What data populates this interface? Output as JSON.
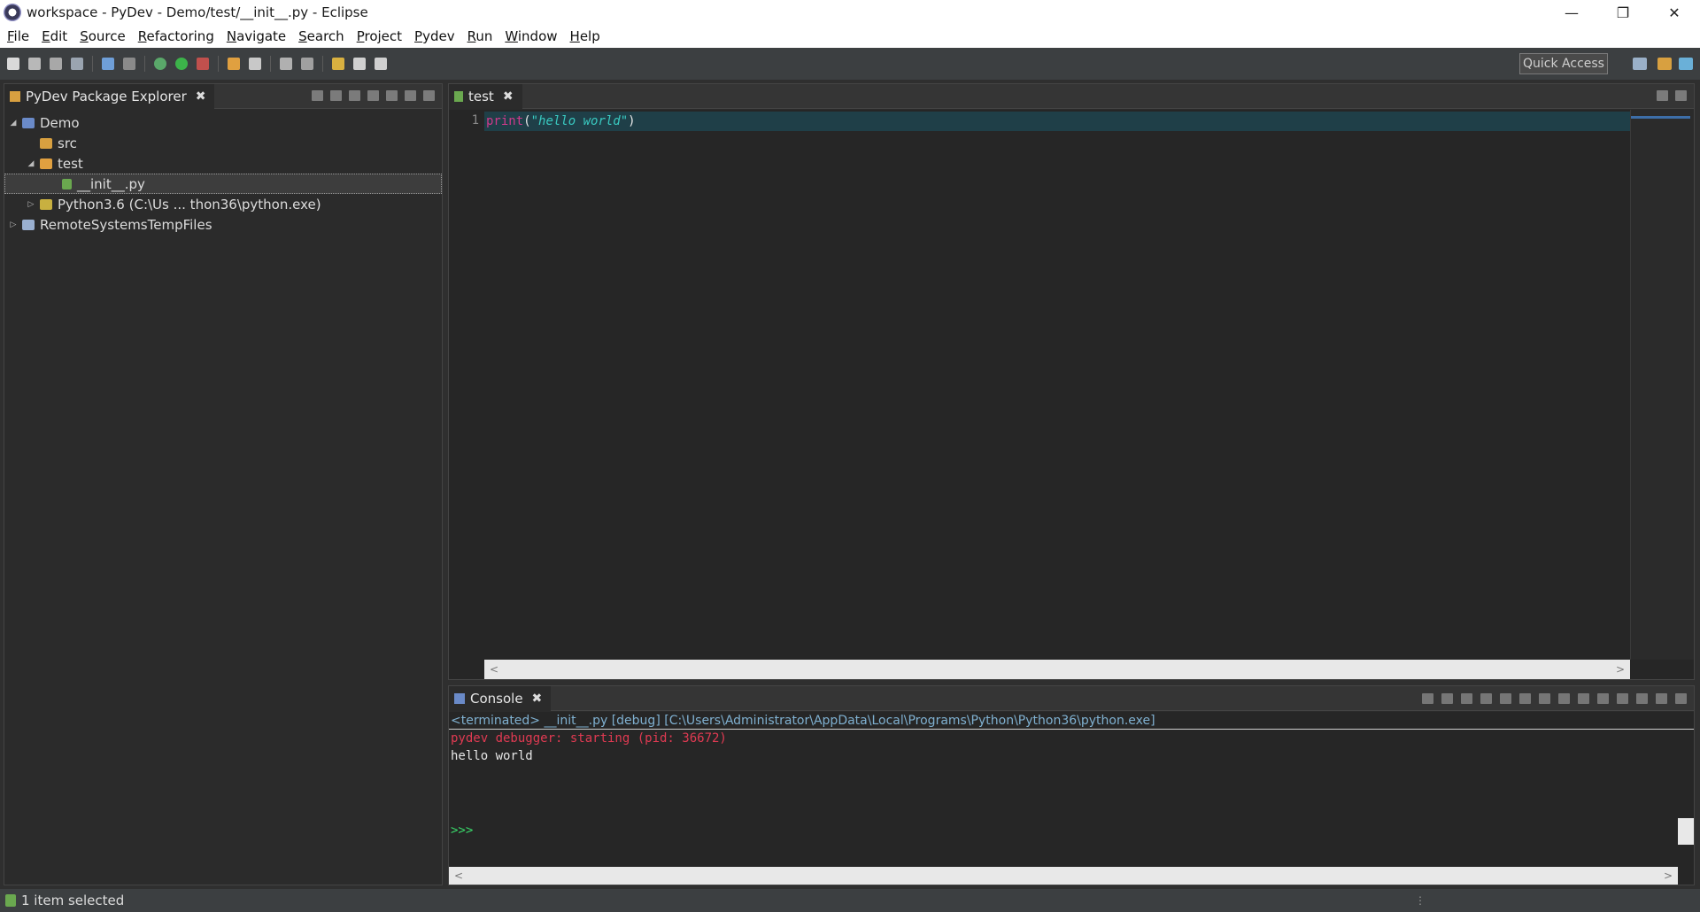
{
  "window": {
    "title": "workspace - PyDev - Demo/test/__init__.py - Eclipse",
    "controls": {
      "minimize": "—",
      "restore": "❐",
      "close": "✕"
    }
  },
  "menu": [
    "File",
    "Edit",
    "Source",
    "Refactoring",
    "Navigate",
    "Search",
    "Project",
    "Pydev",
    "Run",
    "Window",
    "Help"
  ],
  "toolbar": {
    "quick_access": "Quick Access"
  },
  "explorer": {
    "title": "PyDev Package Explorer",
    "close": "✖",
    "tree": [
      {
        "label": "Demo",
        "twisty": "◢"
      },
      {
        "label": "src",
        "twisty": ""
      },
      {
        "label": "test",
        "twisty": "◢"
      },
      {
        "label": "__init__.py",
        "twisty": ""
      },
      {
        "label": "Python3.6  (C:\\Us ... thon36\\python.exe)",
        "twisty": "▷"
      },
      {
        "label": "RemoteSystemsTempFiles",
        "twisty": "▷"
      }
    ]
  },
  "editor": {
    "tab": "test",
    "close": "✖",
    "line_number": "1",
    "code": {
      "keyword": "print",
      "open": "(",
      "string": "\"hello world\"",
      "close": ")"
    },
    "scroll_left": "<",
    "scroll_right": ">"
  },
  "console": {
    "tab": "Console",
    "close": "✖",
    "terminated": "<terminated> __init__.py [debug] [C:\\Users\\Administrator\\AppData\\Local\\Programs\\Python\\Python36\\python.exe]",
    "debugger_line": "pydev debugger: starting (pid: 36672)",
    "output_line": "hello world",
    "prompt": ">>>",
    "scroll_left": "<",
    "scroll_right": ">"
  },
  "status": {
    "text": "1 item selected",
    "grip": "⋮"
  },
  "colors": {
    "keyword": "#d03a8c",
    "string": "#39c9c0",
    "error": "#e03a52",
    "prompt": "#39d96a",
    "current_line": "#1f3f48"
  }
}
